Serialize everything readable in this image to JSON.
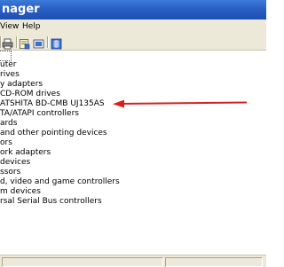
{
  "window": {
    "title": "nager"
  },
  "menu": {
    "items": [
      "View",
      "Help"
    ]
  },
  "toolbar": {
    "buttons": [
      {
        "name": "print-icon"
      },
      {
        "name": "properties-icon"
      },
      {
        "name": "scan-hardware-icon"
      },
      {
        "name": "help-icon"
      }
    ]
  },
  "tree": {
    "items": [
      "uter",
      "rives",
      "y adapters",
      "CD-ROM drives",
      "ATSHITA BD-CMB UJ135AS",
      "TA/ATAPI controllers",
      "ards",
      "and other pointing devices",
      "ors",
      "ork adapters",
      " devices",
      "ssors",
      "d, video and game controllers",
      "m devices",
      "rsal Serial Bus controllers"
    ]
  },
  "annotation": {
    "color": "#d42020"
  }
}
